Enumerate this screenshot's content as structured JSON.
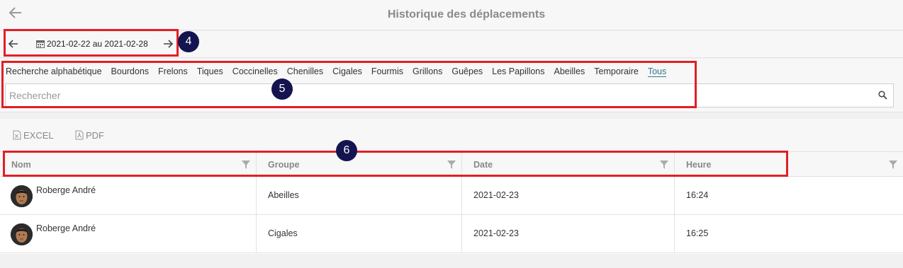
{
  "header": {
    "title": "Historique des déplacements"
  },
  "period": {
    "range_label": "2021-02-22 au 2021-02-28"
  },
  "filters": {
    "tabs": [
      "Recherche alphabétique",
      "Bourdons",
      "Frelons",
      "Tiques",
      "Coccinelles",
      "Chenilles",
      "Cigales",
      "Fourmis",
      "Grillons",
      "Guêpes",
      "Les Papillons",
      "Abeilles",
      "Temporaire",
      "Tous"
    ],
    "active_tab": "Tous",
    "search_placeholder": "Rechercher"
  },
  "exports": {
    "excel_label": "EXCEL",
    "pdf_label": "PDF"
  },
  "table": {
    "columns": [
      "Nom",
      "Groupe",
      "Date",
      "Heure"
    ],
    "rows": [
      {
        "name": "Roberge André",
        "group": "Abeilles",
        "date": "2021-02-23",
        "time": "16:24"
      },
      {
        "name": "Roberge André",
        "group": "Cigales",
        "date": "2021-02-23",
        "time": "16:25"
      }
    ]
  },
  "annotations": {
    "badge_4": "4",
    "badge_5": "5",
    "badge_6": "6"
  },
  "colors": {
    "annotation_red": "#e31e24",
    "badge_navy": "#141450",
    "active_tab_teal": "#337a8a"
  }
}
